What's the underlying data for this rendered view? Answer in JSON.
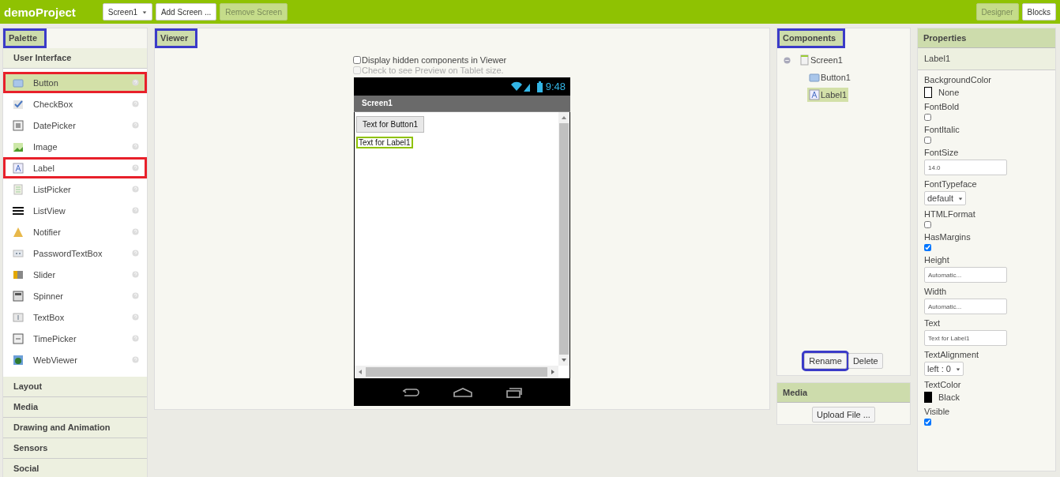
{
  "topbar": {
    "project": "demoProject",
    "screen_dropdown": "Screen1",
    "buttons": [
      {
        "label": "Add Screen ...",
        "disabled": false
      },
      {
        "label": "Remove Screen",
        "disabled": true
      }
    ],
    "modes": [
      {
        "label": "Designer",
        "selected": true
      },
      {
        "label": "Blocks",
        "selected": false
      }
    ]
  },
  "palette": {
    "title": "Palette",
    "annotated": true,
    "groups": [
      {
        "label": "User Interface",
        "items": [
          {
            "label": "Button",
            "kind": "button",
            "selected": true,
            "annotated": true
          },
          {
            "label": "CheckBox",
            "kind": "checkbox",
            "selected": false,
            "annotated": false
          },
          {
            "label": "DatePicker",
            "kind": "datepicker",
            "selected": false,
            "annotated": false
          },
          {
            "label": "Image",
            "kind": "image",
            "selected": false,
            "annotated": false
          },
          {
            "label": "Label",
            "kind": "label",
            "selected": false,
            "annotated": true
          },
          {
            "label": "ListPicker",
            "kind": "listpicker",
            "selected": false,
            "annotated": false
          },
          {
            "label": "ListView",
            "kind": "listview",
            "selected": false,
            "annotated": false
          },
          {
            "label": "Notifier",
            "kind": "notifier",
            "selected": false,
            "annotated": false
          },
          {
            "label": "PasswordTextBox",
            "kind": "password",
            "selected": false,
            "annotated": false
          },
          {
            "label": "Slider",
            "kind": "slider",
            "selected": false,
            "annotated": false
          },
          {
            "label": "Spinner",
            "kind": "spinner",
            "selected": false,
            "annotated": false
          },
          {
            "label": "TextBox",
            "kind": "textbox",
            "selected": false,
            "annotated": false
          },
          {
            "label": "TimePicker",
            "kind": "timepicker",
            "selected": false,
            "annotated": false
          },
          {
            "label": "WebViewer",
            "kind": "webviewer",
            "selected": false,
            "annotated": false
          }
        ]
      },
      {
        "label": "Layout"
      },
      {
        "label": "Media"
      },
      {
        "label": "Drawing and Animation"
      },
      {
        "label": "Sensors"
      },
      {
        "label": "Social"
      }
    ]
  },
  "viewer": {
    "title": "Viewer",
    "annotated": true,
    "options": [
      {
        "label": "Display hidden components in Viewer",
        "checked": false,
        "disabled": false
      },
      {
        "label": "Check to see Preview on Tablet size.",
        "checked": false,
        "disabled": true
      }
    ],
    "phone": {
      "time": "9:48",
      "title": "Screen1",
      "components": [
        {
          "kind": "button",
          "text": "Text for Button1",
          "selected": false
        },
        {
          "kind": "label",
          "text": "Text for Label1",
          "selected": true
        }
      ]
    }
  },
  "components": {
    "title": "Components",
    "annotated": true,
    "tree": [
      {
        "label": "Screen1",
        "kind": "screen",
        "expanded": true,
        "selected": false,
        "children": [
          {
            "label": "Button1",
            "kind": "button",
            "selected": false
          },
          {
            "label": "Label1",
            "kind": "label",
            "selected": true
          }
        ]
      }
    ],
    "buttons": [
      {
        "label": "Rename",
        "annotated": true
      },
      {
        "label": "Delete",
        "annotated": false
      }
    ]
  },
  "media": {
    "title": "Media",
    "button": "Upload File ..."
  },
  "properties": {
    "title": "Properties",
    "component": "Label1",
    "items": [
      {
        "name": "BackgroundColor",
        "kind": "color",
        "value": "None",
        "color": "#ffffff"
      },
      {
        "name": "FontBold",
        "kind": "checkbox",
        "checked": false
      },
      {
        "name": "FontItalic",
        "kind": "checkbox",
        "checked": false
      },
      {
        "name": "FontSize",
        "kind": "text",
        "value": "14.0"
      },
      {
        "name": "FontTypeface",
        "kind": "dropdown",
        "value": "default"
      },
      {
        "name": "HTMLFormat",
        "kind": "checkbox",
        "checked": false
      },
      {
        "name": "HasMargins",
        "kind": "checkbox",
        "checked": true
      },
      {
        "name": "Height",
        "kind": "text",
        "value": "Automatic..."
      },
      {
        "name": "Width",
        "kind": "text",
        "value": "Automatic..."
      },
      {
        "name": "Text",
        "kind": "text",
        "value": "Text for Label1"
      },
      {
        "name": "TextAlignment",
        "kind": "dropdown",
        "value": "left : 0"
      },
      {
        "name": "TextColor",
        "kind": "color",
        "value": "Black",
        "color": "#000000"
      },
      {
        "name": "Visible",
        "kind": "checkbox",
        "checked": true
      }
    ]
  }
}
